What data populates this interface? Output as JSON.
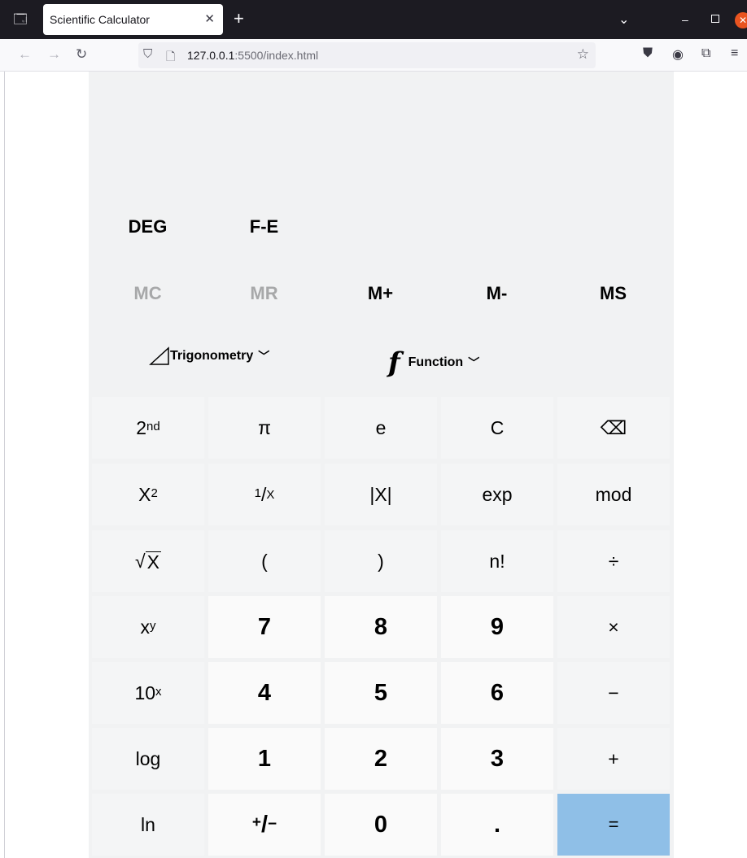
{
  "browser": {
    "tab_title": "Scientific Calculator",
    "url_host": "127.0.0.1",
    "url_rest": ":5500/index.html"
  },
  "calculator": {
    "display": "",
    "modes": [
      "DEG",
      "F-E"
    ],
    "memory": [
      {
        "label": "MC",
        "enabled": false
      },
      {
        "label": "MR",
        "enabled": false
      },
      {
        "label": "M+",
        "enabled": true
      },
      {
        "label": "M-",
        "enabled": true
      },
      {
        "label": "MS",
        "enabled": true
      }
    ],
    "dropdowns": {
      "trigonometry": "Trigonometry",
      "function": "Function",
      "function_icon": "f"
    },
    "keys": {
      "second_base": "2",
      "second_sup": "nd",
      "pi": "π",
      "e": "e",
      "clear": "C",
      "backspace": "⌫",
      "square_base": "X",
      "square_sup": "2",
      "reciprocal_sup": "1",
      "reciprocal_mid": "/",
      "reciprocal_sub": "X",
      "abs": "|X|",
      "exp": "exp",
      "mod": "mod",
      "sqrt_sign": "√",
      "sqrt_arg": "X",
      "lparen": "(",
      "rparen": ")",
      "factorial": "n!",
      "divide": "÷",
      "power_base": "x",
      "power_sup": "y",
      "seven": "7",
      "eight": "8",
      "nine": "9",
      "multiply": "×",
      "ten_pow_base": "10",
      "ten_pow_sup": "x",
      "four": "4",
      "five": "5",
      "six": "6",
      "minus": "−",
      "log": "log",
      "one": "1",
      "two": "2",
      "three": "3",
      "plus": "+",
      "ln": "ln",
      "negate_sup": "+",
      "negate_mid": "/",
      "negate_sub": "−",
      "zero": "0",
      "decimal": ".",
      "equals": "="
    }
  }
}
